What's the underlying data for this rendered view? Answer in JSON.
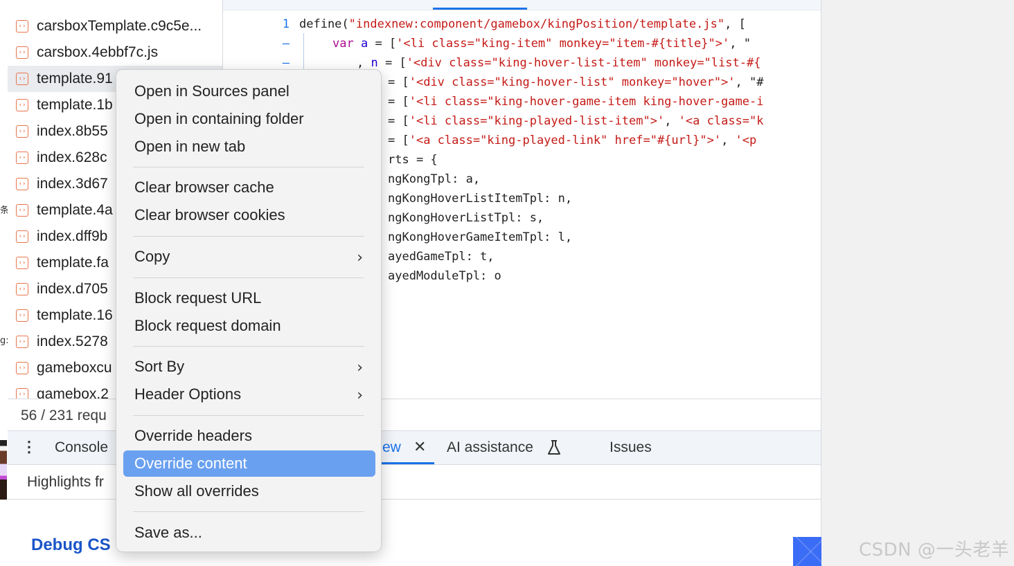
{
  "files": [
    {
      "name": "carsboxTemplate.c9c5e..."
    },
    {
      "name": "carsbox.4ebbf7c.js"
    },
    {
      "name": "template.91"
    },
    {
      "name": "template.1b"
    },
    {
      "name": "index.8b55"
    },
    {
      "name": "index.628c"
    },
    {
      "name": "index.3d67"
    },
    {
      "name": "template.4a"
    },
    {
      "name": "index.dff9b"
    },
    {
      "name": "template.fa"
    },
    {
      "name": "index.d705"
    },
    {
      "name": "template.16"
    },
    {
      "name": "index.5278"
    },
    {
      "name": "gameboxcu"
    },
    {
      "name": "gamebox.2"
    }
  ],
  "left_gutter": {
    "glyph_1": "条",
    "glyph_2": "g:"
  },
  "editor": {
    "line_numbers": [
      "1",
      "–",
      "–"
    ],
    "lines": [
      {
        "plain": "define(",
        "str": "\"indexnew:component/gamebox/kingPosition/template.js\"",
        "tail": ", ["
      },
      {
        "kw": "var",
        "var": "a",
        "plain": " = [",
        "str": "'<li class=\"king-item\" monkey=\"item-#{title}\">'",
        "tail": ", \""
      },
      {
        "lead": ", ",
        "var": "n",
        "plain": " = [",
        "str": "'<div class=\"king-hover-list-item\" monkey=\"list-#{"
      },
      {
        "plain": "= [",
        "str": "'<div class=\"king-hover-list\" monkey=\"hover\">'",
        "tail": ", \"#"
      },
      {
        "plain": "= [",
        "str": "'<li class=\"king-hover-game-item king-hover-game-i"
      },
      {
        "plain": "= [",
        "str": "'<li class=\"king-played-list-item\">'",
        "tail": ", ",
        "str2": "'<a class=\"k"
      },
      {
        "plain": "= [",
        "str": "'<a class=\"king-played-link\" href=\"#{url}\">'",
        "tail": ", ",
        "str2": "'<p"
      },
      {
        "plain": "rts = {"
      },
      {
        "plain": "ngKongTpl: a,"
      },
      {
        "plain": "ngKongHoverListItemTpl: n,"
      },
      {
        "plain": "ngKongHoverListTpl: s,"
      },
      {
        "plain": "ngKongHoverGameItemTpl: l,"
      },
      {
        "plain": "ayedGameTpl: t,"
      },
      {
        "plain": "ayedModuleTpl: o"
      }
    ]
  },
  "status": {
    "text": "56 / 231 requ"
  },
  "drawer": {
    "tabs": [
      {
        "label": "Console"
      },
      {
        "label": "ew",
        "active": true
      },
      {
        "label": "AI assistance"
      },
      {
        "label": "Issues"
      }
    ],
    "close_glyph": "✕",
    "highlights": "Highlights fr",
    "debug_title": "Debug CS"
  },
  "context_menu": {
    "items": [
      {
        "label": "Open in Sources panel"
      },
      {
        "label": "Open in containing folder"
      },
      {
        "label": "Open in new tab"
      },
      {
        "label": "Clear browser cache"
      },
      {
        "label": "Clear browser cookies"
      },
      {
        "label": "Copy",
        "submenu": true
      },
      {
        "label": "Block request URL"
      },
      {
        "label": "Block request domain"
      },
      {
        "label": "Sort By",
        "submenu": true
      },
      {
        "label": "Header Options",
        "submenu": true
      },
      {
        "label": "Override headers"
      },
      {
        "label": "Override content",
        "highlighted": true
      },
      {
        "label": "Show all overrides"
      },
      {
        "label": "Save as..."
      }
    ],
    "submenu_glyph": "›"
  },
  "watermark": {
    "text": "CSDN @一头老羊"
  },
  "colors": {
    "accent": "#1a73e8",
    "menu_highlight": "#6aa0f0",
    "string": "#c41a16",
    "keyword": "#aa0d91",
    "file_icon": "#e8744b"
  }
}
